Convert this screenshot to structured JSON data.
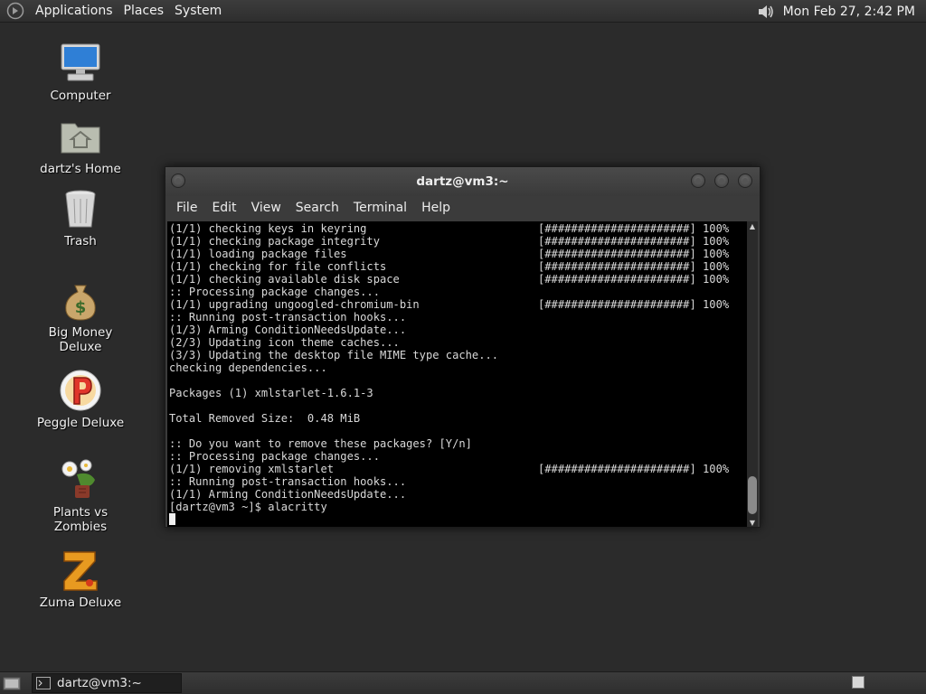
{
  "top_panel": {
    "menus": [
      "Applications",
      "Places",
      "System"
    ],
    "clock": "Mon Feb 27,  2:42 PM",
    "logo_icon": "gnome-foot-icon",
    "volume_icon": "speaker-icon"
  },
  "desktop_icons": [
    {
      "label": "Computer",
      "icon": "computer-icon"
    },
    {
      "label": "dartz's Home",
      "icon": "home-folder-icon"
    },
    {
      "label": "Trash",
      "icon": "trash-icon"
    },
    {
      "label": "Big Money Deluxe",
      "icon": "money-bag-icon"
    },
    {
      "label": "Peggle Deluxe",
      "icon": "peggle-icon"
    },
    {
      "label": "Plants vs Zombies",
      "icon": "plants-icon"
    },
    {
      "label": "Zuma Deluxe",
      "icon": "zuma-icon"
    }
  ],
  "terminal": {
    "title": "dartz@vm3:~",
    "menu": [
      "File",
      "Edit",
      "View",
      "Search",
      "Terminal",
      "Help"
    ],
    "lines": [
      {
        "text": "(1/1) checking keys in keyring",
        "progress": "[######################] 100%"
      },
      {
        "text": "(1/1) checking package integrity",
        "progress": "[######################] 100%"
      },
      {
        "text": "(1/1) loading package files",
        "progress": "[######################] 100%"
      },
      {
        "text": "(1/1) checking for file conflicts",
        "progress": "[######################] 100%"
      },
      {
        "text": "(1/1) checking available disk space",
        "progress": "[######################] 100%"
      },
      {
        "text": ":: Processing package changes...",
        "progress": ""
      },
      {
        "text": "(1/1) upgrading ungoogled-chromium-bin",
        "progress": "[######################] 100%"
      },
      {
        "text": ":: Running post-transaction hooks...",
        "progress": ""
      },
      {
        "text": "(1/3) Arming ConditionNeedsUpdate...",
        "progress": ""
      },
      {
        "text": "(2/3) Updating icon theme caches...",
        "progress": ""
      },
      {
        "text": "(3/3) Updating the desktop file MIME type cache...",
        "progress": ""
      },
      {
        "text": "checking dependencies...",
        "progress": ""
      },
      {
        "text": "",
        "progress": ""
      },
      {
        "text": "Packages (1) xmlstarlet-1.6.1-3",
        "progress": ""
      },
      {
        "text": "",
        "progress": ""
      },
      {
        "text": "Total Removed Size:  0.48 MiB",
        "progress": ""
      },
      {
        "text": "",
        "progress": ""
      },
      {
        "text": ":: Do you want to remove these packages? [Y/n]",
        "progress": ""
      },
      {
        "text": ":: Processing package changes...",
        "progress": ""
      },
      {
        "text": "(1/1) removing xmlstarlet",
        "progress": "[######################] 100%"
      },
      {
        "text": ":: Running post-transaction hooks...",
        "progress": ""
      },
      {
        "text": "(1/1) Arming ConditionNeedsUpdate...",
        "progress": ""
      },
      {
        "text": "[dartz@vm3 ~]$ alacritty",
        "progress": ""
      }
    ]
  },
  "bottom_panel": {
    "task": "dartz@vm3:~"
  },
  "colors": {
    "desktop": "#2b2b2b",
    "terminal_bg": "#000000",
    "terminal_fg": "#d9d9d9"
  }
}
